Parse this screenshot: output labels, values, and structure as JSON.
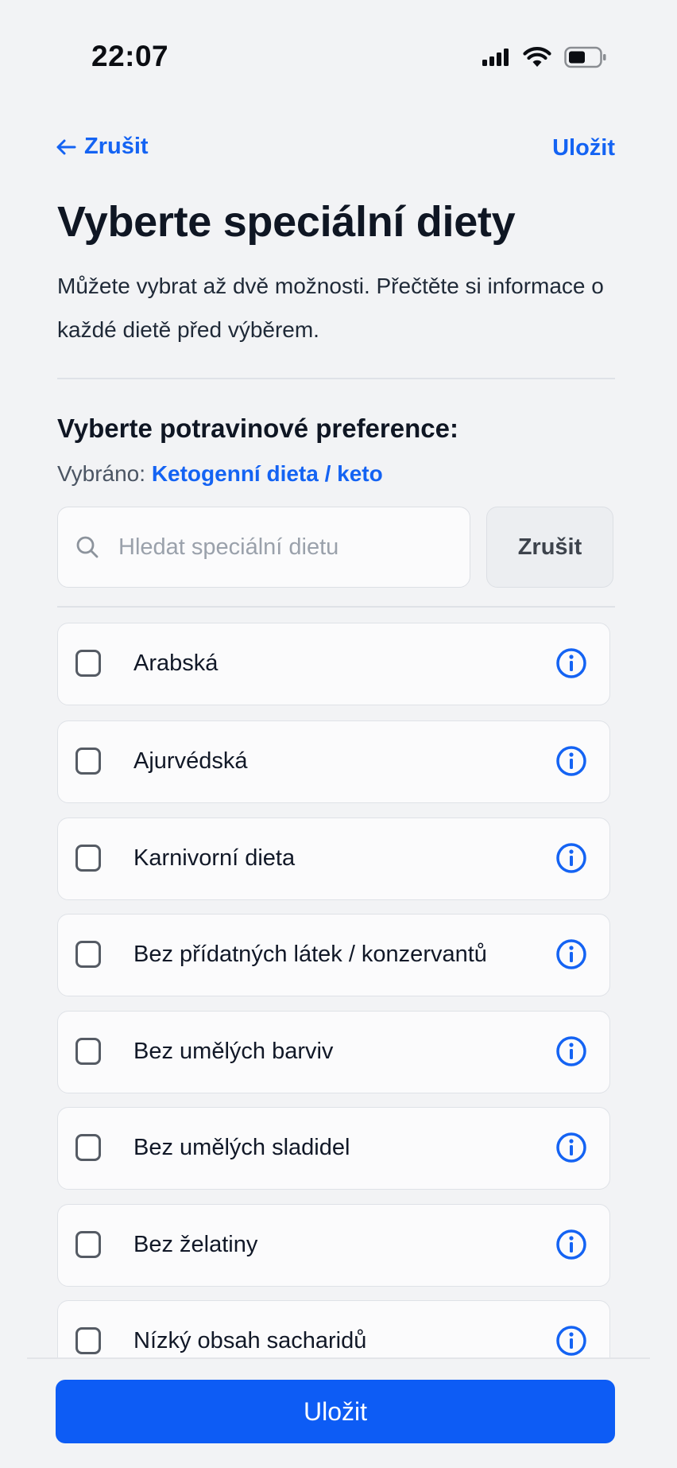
{
  "status_bar": {
    "time": "22:07",
    "icons": [
      "signal-icon",
      "wifi-icon",
      "battery-icon"
    ]
  },
  "nav": {
    "back_label": "Zrušit",
    "save_label": "Uložit"
  },
  "header": {
    "title": "Vyberte speciální diety",
    "subtitle": "Můžete vybrat až dvě možnosti. Přečtěte si informace o každé dietě před výběrem."
  },
  "selection": {
    "heading": "Vyberte potravinové preference:",
    "selected_prefix": "Vybráno:",
    "selected_value": "Ketogenní dieta / keto"
  },
  "search": {
    "placeholder": "Hledat speciální dietu",
    "value": "",
    "cancel_label": "Zrušit"
  },
  "diets": [
    {
      "label": "Arabská",
      "checked": false
    },
    {
      "label": "Ajurvédská",
      "checked": false
    },
    {
      "label": "Karnivorní dieta",
      "checked": false
    },
    {
      "label": "Bez přídatných látek / konzervantů",
      "checked": false
    },
    {
      "label": "Bez umělých barviv",
      "checked": false
    },
    {
      "label": "Bez umělých sladidel",
      "checked": false
    },
    {
      "label": "Bez želatiny",
      "checked": false
    },
    {
      "label": "Nízký obsah sacharidů",
      "checked": false
    }
  ],
  "footer": {
    "save_label": "Uložit"
  },
  "colors": {
    "accent": "#1463f3",
    "primary_button": "#0d5cf5",
    "background": "#f2f3f5"
  }
}
